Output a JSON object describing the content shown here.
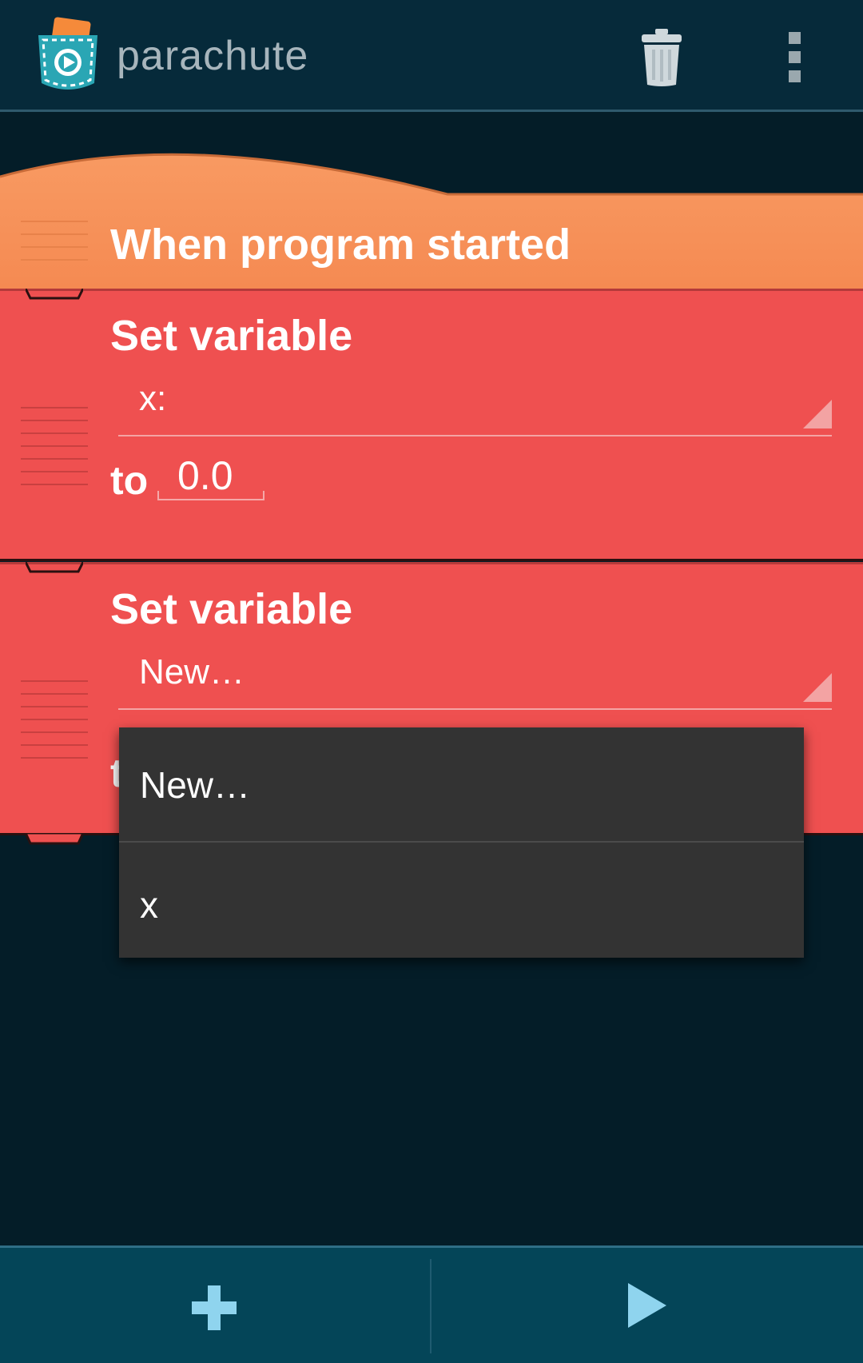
{
  "action_bar": {
    "title": "parachute",
    "icons": [
      "app-logo-icon",
      "trash-icon",
      "overflow-menu-icon"
    ]
  },
  "blocks": {
    "hat": {
      "label": "When program started",
      "color": "#f89a60"
    },
    "set_variable_1": {
      "label": "Set variable",
      "variable": "x:",
      "to_label": "to",
      "value": "0.0",
      "color": "#ef5050"
    },
    "set_variable_2": {
      "label": "Set variable",
      "variable": "New…",
      "to_label": "t",
      "color": "#ef5050"
    }
  },
  "dropdown_popup": {
    "options": [
      "New…",
      "x"
    ]
  },
  "bottom_bar": {
    "icons": [
      "add-icon",
      "play-icon"
    ],
    "accent": "#8fd4ee"
  }
}
